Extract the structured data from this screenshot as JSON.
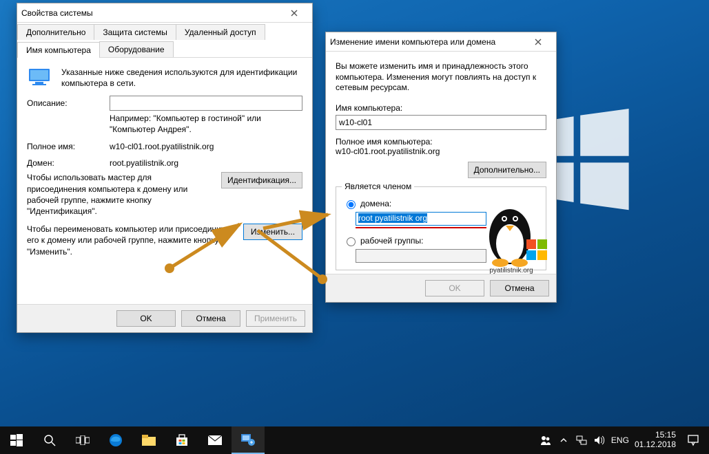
{
  "desktop": {
    "logo": "windows-logo"
  },
  "dialog1": {
    "title": "Свойства системы",
    "tabsRow1": [
      "Дополнительно",
      "Защита системы",
      "Удаленный доступ"
    ],
    "tabsRow2": [
      "Имя компьютера",
      "Оборудование"
    ],
    "activeTab": "Имя компьютера",
    "intro": "Указанные ниже сведения используются для идентификации компьютера в сети.",
    "description_label": "Описание:",
    "description_value": "",
    "description_hint": "Например: \"Компьютер в гостиной\" или \"Компьютер Андрея\".",
    "fullname_label": "Полное имя:",
    "fullname_value": "w10-cl01.root.pyatilistnik.org",
    "domain_label": "Домен:",
    "domain_value": "root.pyatilistnik.org",
    "wizard_text": "Чтобы использовать мастер для присоединения компьютера к домену или рабочей группе, нажмите кнопку \"Идентификация\".",
    "identify_btn": "Идентификация...",
    "rename_text": "Чтобы переименовать компьютер или присоединить его к домену или рабочей группе, нажмите кнопку \"Изменить\".",
    "change_btn": "Изменить...",
    "ok_btn": "OK",
    "cancel_btn": "Отмена",
    "apply_btn": "Применить"
  },
  "dialog2": {
    "title": "Изменение имени компьютера или домена",
    "intro": "Вы можете изменить имя и принадлежность этого компьютера. Изменения могут повлиять на доступ к сетевым ресурсам.",
    "compname_label": "Имя компьютера:",
    "compname_value": "w10-cl01",
    "fullname_label": "Полное имя компьютера:",
    "fullname_value": "w10-cl01.root.pyatilistnik.org",
    "more_btn": "Дополнительно...",
    "group_legend": "Является членом",
    "radio_domain": "домена:",
    "domain_value": "root pyatilistnik org",
    "radio_workgroup": "рабочей группы:",
    "workgroup_value": "",
    "ok_btn": "OK",
    "cancel_btn": "Отмена",
    "watermark": "pyatilistnik.org"
  },
  "taskbar": {
    "lang": "ENG",
    "time": "15:15",
    "date": "01.12.2018"
  }
}
